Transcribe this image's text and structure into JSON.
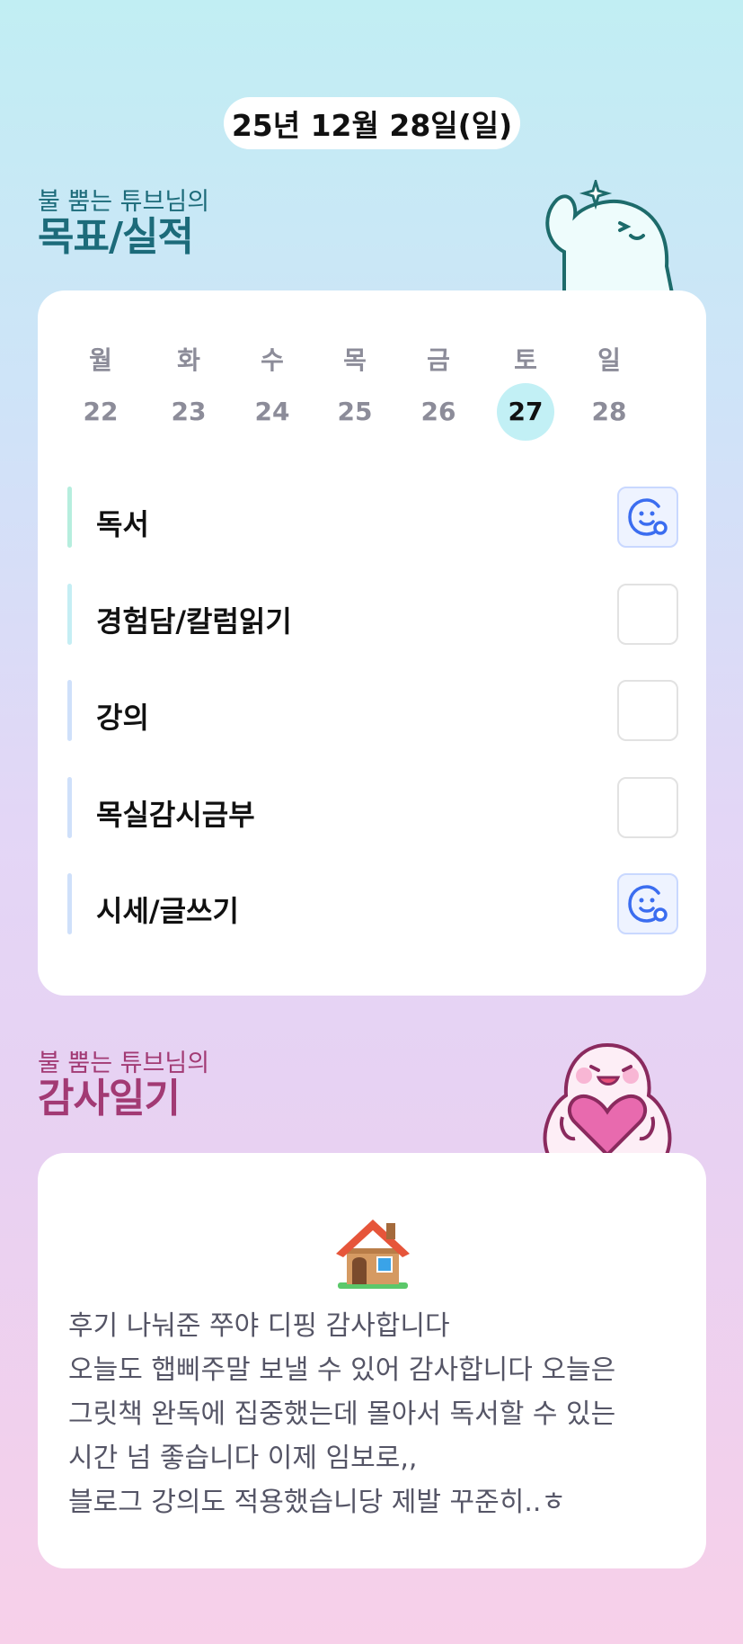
{
  "date_label": "25년 12월 28일(일)",
  "goals_section": {
    "subtitle": "불 뿜는 튜브님의",
    "title": "목표/실적"
  },
  "week": {
    "days": [
      {
        "label": "월",
        "num": "22"
      },
      {
        "label": "화",
        "num": "23"
      },
      {
        "label": "수",
        "num": "24"
      },
      {
        "label": "목",
        "num": "25"
      },
      {
        "label": "금",
        "num": "26"
      },
      {
        "label": "토",
        "num": "27",
        "selected": true
      },
      {
        "label": "일",
        "num": "28"
      }
    ]
  },
  "tasks": [
    {
      "name": "독서",
      "done": true,
      "bar_color": "#b6eede"
    },
    {
      "name": "경험담/칼럼읽기",
      "done": false,
      "bar_color": "#c5eef4"
    },
    {
      "name": "강의",
      "done": false,
      "bar_color": "#cfe0fa"
    },
    {
      "name": "목실감시금부",
      "done": false,
      "bar_color": "#cfe0fa"
    },
    {
      "name": "시세/글쓰기",
      "done": true,
      "bar_color": "#cfe0fa"
    }
  ],
  "gratitude_section": {
    "subtitle": "불 뿜는 튜브님의",
    "title": "감사일기"
  },
  "diary": {
    "icon": "house-icon",
    "lines": [
      "후기 나눠준 쭈야 디핑 감사합니다",
      "오늘도 햅삐주말 보낼 수 있어 감사합니다 오늘은",
      "그릿책 완독에 집중했는데 몰아서 독서할 수 있는",
      "시간 넘 좋습니다 이제 임보로,,",
      "블로그 강의도 적용했습니당 제발 꾸준히..ㅎ"
    ]
  },
  "colors": {
    "goals_title": "#1c6b7a",
    "gratitude_title": "#a23a74",
    "selected_day": "#c2f0f5",
    "done_icon": "#3b6df0"
  }
}
